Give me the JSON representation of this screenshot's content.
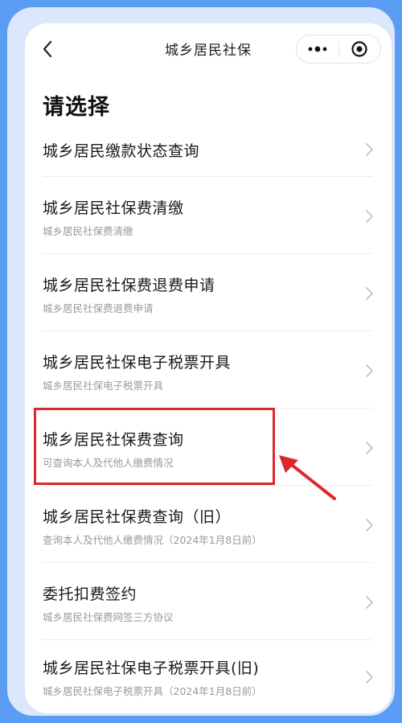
{
  "navbar": {
    "title": "城乡居民社保",
    "back_icon": "chevron-left-icon",
    "more_icon": "more-dots-icon",
    "close_icon": "mini-program-close-icon"
  },
  "page": {
    "heading": "请选择"
  },
  "items": [
    {
      "title": "城乡居民缴款状态查询",
      "subtitle": ""
    },
    {
      "title": "城乡居民社保费清缴",
      "subtitle": "城乡居民社保费清缴"
    },
    {
      "title": "城乡居民社保费退费申请",
      "subtitle": "城乡居民社保费退费申请"
    },
    {
      "title": "城乡居民社保电子税票开具",
      "subtitle": "城乡居民社保电子税票开具"
    },
    {
      "title": "城乡居民社保费查询",
      "subtitle": "可查询本人及代他人缴费情况"
    },
    {
      "title": "城乡居民社保费查询（旧）",
      "subtitle": "查询本人及代他人缴费情况（2024年1月8日前）"
    },
    {
      "title": "委托扣费签约",
      "subtitle": "城乡居民社保费网签三方协议"
    },
    {
      "title": "城乡居民社保电子税票开具(旧)",
      "subtitle": "城乡居民社保电子税票开具（2024年1月8日前）"
    }
  ],
  "annotation": {
    "highlight_color": "#e0262d"
  },
  "colors": {
    "background": "#5b9cf4",
    "card": "#ffffff",
    "accent": "#e0262d"
  }
}
